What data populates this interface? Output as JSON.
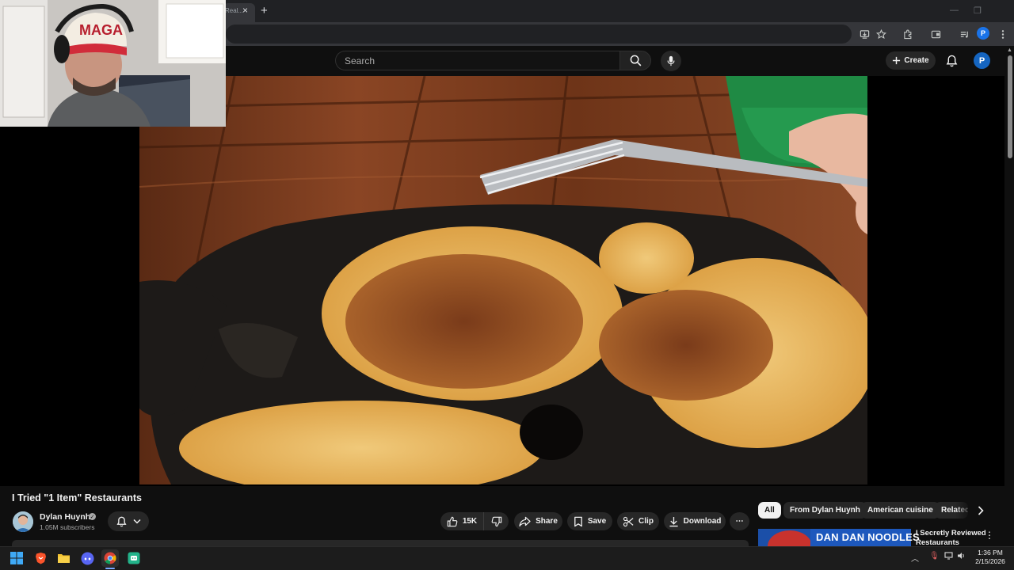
{
  "browser": {
    "tab_title": "Real...",
    "tab_close": "×",
    "new_tab": "+",
    "window_controls": [
      "—",
      "❐"
    ]
  },
  "youtube": {
    "search_placeholder": "Search",
    "create_label": "Create",
    "avatar_letter": "P"
  },
  "video": {
    "title": "I Tried \"1 Item\" Restaurants",
    "channel_name": "Dylan Huynh",
    "subscribers": "1.05M subscribers",
    "likes": "15K",
    "actions": {
      "share": "Share",
      "save": "Save",
      "clip": "Clip",
      "download": "Download",
      "more": "⋯"
    }
  },
  "chips": {
    "all": "All",
    "from_channel": "From Dylan Huynh",
    "american": "American cuisine",
    "related": "Related"
  },
  "recommendation": {
    "thumb_text": "DAN DAN NOODLES",
    "title": "I Secretly Reviewed Restaurants Askin...",
    "menu": "⋮"
  },
  "taskbar": {
    "time": "1:36 PM",
    "date": "2/15/2026"
  },
  "colors": {
    "accent_blue": "#1565c0",
    "youtube_bg": "#0f0f0f",
    "pill_bg": "#272727"
  }
}
